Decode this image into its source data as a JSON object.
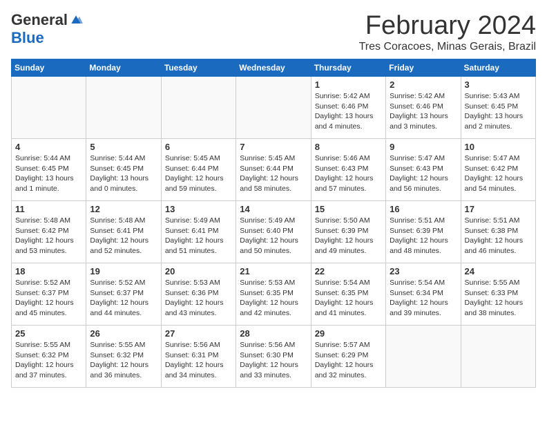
{
  "logo": {
    "general": "General",
    "blue": "Blue"
  },
  "title": {
    "month_year": "February 2024",
    "location": "Tres Coracoes, Minas Gerais, Brazil"
  },
  "weekdays": [
    "Sunday",
    "Monday",
    "Tuesday",
    "Wednesday",
    "Thursday",
    "Friday",
    "Saturday"
  ],
  "weeks": [
    [
      {
        "day": "",
        "info": ""
      },
      {
        "day": "",
        "info": ""
      },
      {
        "day": "",
        "info": ""
      },
      {
        "day": "",
        "info": ""
      },
      {
        "day": "1",
        "info": "Sunrise: 5:42 AM\nSunset: 6:46 PM\nDaylight: 13 hours\nand 4 minutes."
      },
      {
        "day": "2",
        "info": "Sunrise: 5:42 AM\nSunset: 6:46 PM\nDaylight: 13 hours\nand 3 minutes."
      },
      {
        "day": "3",
        "info": "Sunrise: 5:43 AM\nSunset: 6:45 PM\nDaylight: 13 hours\nand 2 minutes."
      }
    ],
    [
      {
        "day": "4",
        "info": "Sunrise: 5:44 AM\nSunset: 6:45 PM\nDaylight: 13 hours\nand 1 minute."
      },
      {
        "day": "5",
        "info": "Sunrise: 5:44 AM\nSunset: 6:45 PM\nDaylight: 13 hours\nand 0 minutes."
      },
      {
        "day": "6",
        "info": "Sunrise: 5:45 AM\nSunset: 6:44 PM\nDaylight: 12 hours\nand 59 minutes."
      },
      {
        "day": "7",
        "info": "Sunrise: 5:45 AM\nSunset: 6:44 PM\nDaylight: 12 hours\nand 58 minutes."
      },
      {
        "day": "8",
        "info": "Sunrise: 5:46 AM\nSunset: 6:43 PM\nDaylight: 12 hours\nand 57 minutes."
      },
      {
        "day": "9",
        "info": "Sunrise: 5:47 AM\nSunset: 6:43 PM\nDaylight: 12 hours\nand 56 minutes."
      },
      {
        "day": "10",
        "info": "Sunrise: 5:47 AM\nSunset: 6:42 PM\nDaylight: 12 hours\nand 54 minutes."
      }
    ],
    [
      {
        "day": "11",
        "info": "Sunrise: 5:48 AM\nSunset: 6:42 PM\nDaylight: 12 hours\nand 53 minutes."
      },
      {
        "day": "12",
        "info": "Sunrise: 5:48 AM\nSunset: 6:41 PM\nDaylight: 12 hours\nand 52 minutes."
      },
      {
        "day": "13",
        "info": "Sunrise: 5:49 AM\nSunset: 6:41 PM\nDaylight: 12 hours\nand 51 minutes."
      },
      {
        "day": "14",
        "info": "Sunrise: 5:49 AM\nSunset: 6:40 PM\nDaylight: 12 hours\nand 50 minutes."
      },
      {
        "day": "15",
        "info": "Sunrise: 5:50 AM\nSunset: 6:39 PM\nDaylight: 12 hours\nand 49 minutes."
      },
      {
        "day": "16",
        "info": "Sunrise: 5:51 AM\nSunset: 6:39 PM\nDaylight: 12 hours\nand 48 minutes."
      },
      {
        "day": "17",
        "info": "Sunrise: 5:51 AM\nSunset: 6:38 PM\nDaylight: 12 hours\nand 46 minutes."
      }
    ],
    [
      {
        "day": "18",
        "info": "Sunrise: 5:52 AM\nSunset: 6:37 PM\nDaylight: 12 hours\nand 45 minutes."
      },
      {
        "day": "19",
        "info": "Sunrise: 5:52 AM\nSunset: 6:37 PM\nDaylight: 12 hours\nand 44 minutes."
      },
      {
        "day": "20",
        "info": "Sunrise: 5:53 AM\nSunset: 6:36 PM\nDaylight: 12 hours\nand 43 minutes."
      },
      {
        "day": "21",
        "info": "Sunrise: 5:53 AM\nSunset: 6:35 PM\nDaylight: 12 hours\nand 42 minutes."
      },
      {
        "day": "22",
        "info": "Sunrise: 5:54 AM\nSunset: 6:35 PM\nDaylight: 12 hours\nand 41 minutes."
      },
      {
        "day": "23",
        "info": "Sunrise: 5:54 AM\nSunset: 6:34 PM\nDaylight: 12 hours\nand 39 minutes."
      },
      {
        "day": "24",
        "info": "Sunrise: 5:55 AM\nSunset: 6:33 PM\nDaylight: 12 hours\nand 38 minutes."
      }
    ],
    [
      {
        "day": "25",
        "info": "Sunrise: 5:55 AM\nSunset: 6:32 PM\nDaylight: 12 hours\nand 37 minutes."
      },
      {
        "day": "26",
        "info": "Sunrise: 5:55 AM\nSunset: 6:32 PM\nDaylight: 12 hours\nand 36 minutes."
      },
      {
        "day": "27",
        "info": "Sunrise: 5:56 AM\nSunset: 6:31 PM\nDaylight: 12 hours\nand 34 minutes."
      },
      {
        "day": "28",
        "info": "Sunrise: 5:56 AM\nSunset: 6:30 PM\nDaylight: 12 hours\nand 33 minutes."
      },
      {
        "day": "29",
        "info": "Sunrise: 5:57 AM\nSunset: 6:29 PM\nDaylight: 12 hours\nand 32 minutes."
      },
      {
        "day": "",
        "info": ""
      },
      {
        "day": "",
        "info": ""
      }
    ]
  ]
}
